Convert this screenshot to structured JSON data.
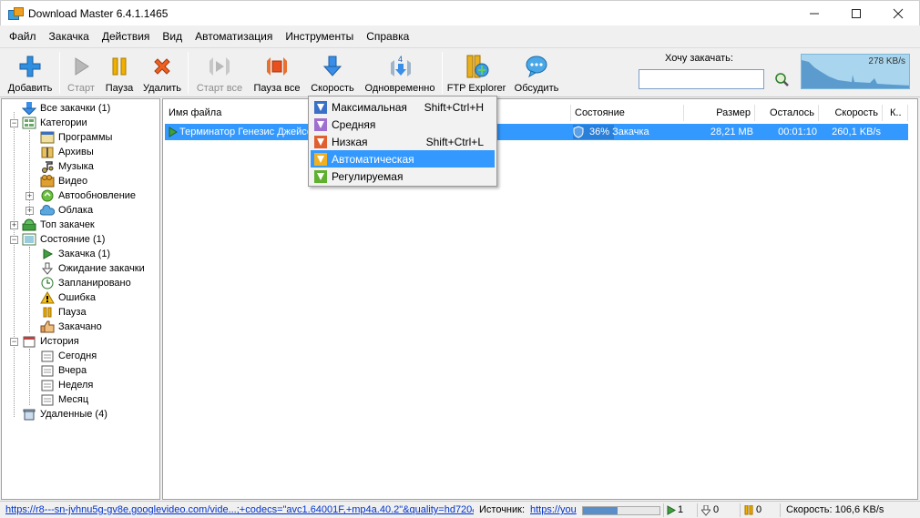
{
  "window": {
    "title": "Download Master 6.4.1.1465"
  },
  "menu": [
    "Файл",
    "Закачка",
    "Действия",
    "Вид",
    "Автоматизация",
    "Инструменты",
    "Справка"
  ],
  "toolbar": {
    "add": "Добавить",
    "start": "Старт",
    "pause": "Пауза",
    "delete": "Удалить",
    "start_all": "Старт все",
    "pause_all": "Пауза все",
    "speed": "Скорость",
    "simultaneous": "Одновременно",
    "simultaneous_count": "4",
    "ftp": "FTP Explorer",
    "discuss": "Обсудить"
  },
  "want": {
    "label": "Хочу закачать:",
    "value": ""
  },
  "graph": {
    "label": "278 KB/s"
  },
  "tree": {
    "all": "Все закачки (1)",
    "categories": "Категории",
    "programs": "Программы",
    "archives": "Архивы",
    "music": "Музыка",
    "video": "Видео",
    "autoupdate": "Автообновление",
    "clouds": "Облака",
    "top": "Топ закачек",
    "state": "Состояние (1)",
    "downloading": "Закачка (1)",
    "waiting": "Ожидание закачки",
    "scheduled": "Запланировано",
    "error": "Ошибка",
    "paused": "Пауза",
    "done": "Закачано",
    "history": "История",
    "today": "Сегодня",
    "yesterday": "Вчера",
    "week": "Неделя",
    "month": "Месяц",
    "deleted": "Удаленные (4)"
  },
  "columns": {
    "name": "Имя файла",
    "state": "Состояние",
    "size": "Размер",
    "left": "Осталось",
    "speed": "Скорость",
    "k": "К.."
  },
  "row": {
    "name": "Терминатор Генезис  Джейсо",
    "state": "36% Закачка",
    "size": "28,21 MB",
    "left": "00:01:10",
    "speed": "260,1 KB/s",
    "progress": 0.36
  },
  "speed_menu": [
    {
      "label": "Максимальная",
      "shortcut": "Shift+Ctrl+H"
    },
    {
      "label": "Средняя",
      "shortcut": ""
    },
    {
      "label": "Низкая",
      "shortcut": "Shift+Ctrl+L"
    },
    {
      "label": "Автоматическая",
      "shortcut": ""
    },
    {
      "label": "Регулируемая",
      "shortcut": ""
    }
  ],
  "status": {
    "url": "https://r8---sn-jvhnu5g-gv8e.googlevideo.com/vide...;+codecs=\"avc1.64001F,+mp4a.40.2\"&quality=hd720&",
    "source_label": "Источник:",
    "source_url": "https://you",
    "active": "1",
    "waiting": "0",
    "paused": "0",
    "speed": "Скорость: 106,6 KB/s",
    "progress": 0.45
  }
}
